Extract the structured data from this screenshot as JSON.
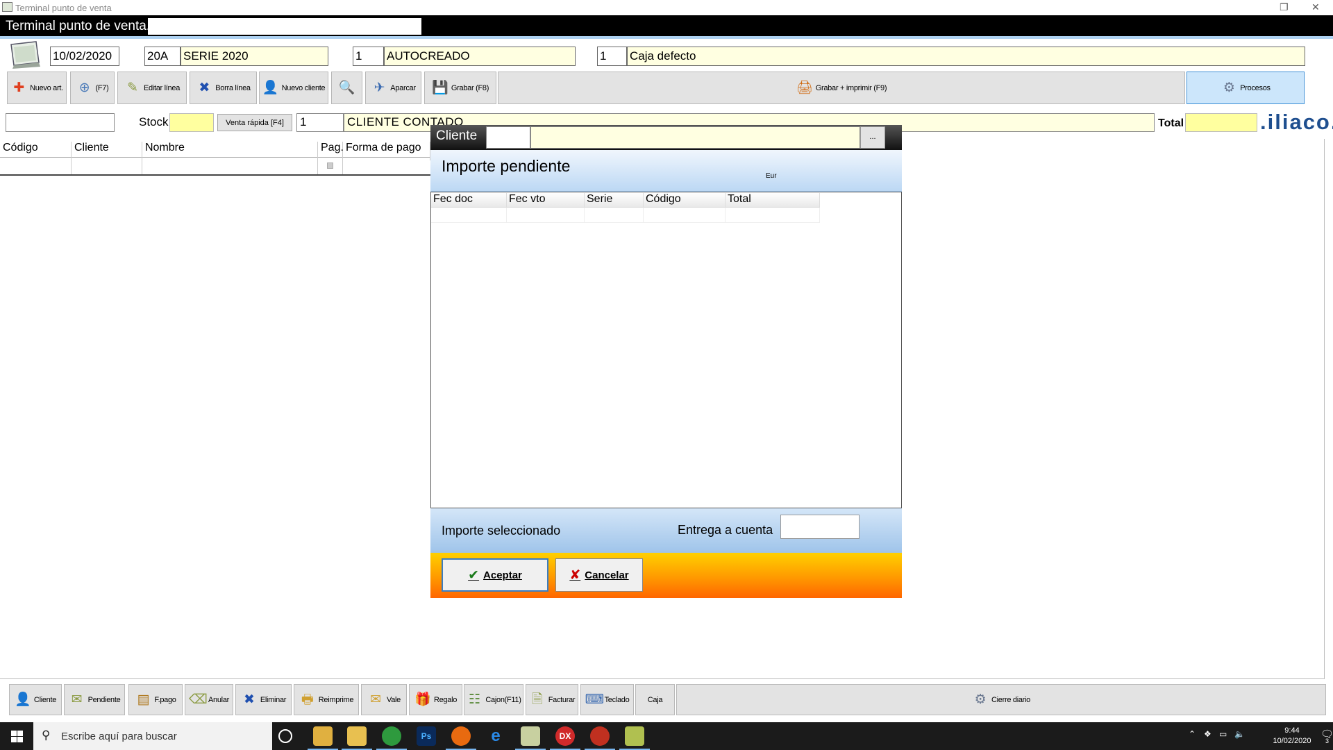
{
  "window": {
    "title": "Terminal punto de venta",
    "restore_glyph": "❐",
    "close_glyph": "✕"
  },
  "header": {
    "title": "Terminal punto de venta."
  },
  "info": {
    "date": "10/02/2020",
    "series_code": "20A",
    "series_name": "SERIE 2020",
    "user_code": "1",
    "user_name": "AUTOCREADO",
    "cash_code": "1",
    "cash_name": "Caja defecto"
  },
  "toolbar": {
    "new_article": "Nuevo art.",
    "f7": "(F7)",
    "edit_line": "Editar línea",
    "delete_line": "Borra línea",
    "new_client": "Nuevo cliente",
    "park": "Aparcar",
    "save": "Grabar (F8)",
    "save_print": "Grabar + imprimir (F9)",
    "processes": "Procesos"
  },
  "search": {
    "stock_label": "Stock",
    "quick_sale": "Venta rápida [F4]",
    "client_code": "1",
    "client_name": "CLIENTE CONTADO",
    "total_label": "Total",
    "brand": ".iliaco."
  },
  "main_table": {
    "columns": [
      "Código",
      "Cliente",
      "Nombre",
      "Pag.",
      "Forma de pago"
    ]
  },
  "dialog": {
    "title": "Cliente",
    "browse": "...",
    "pending_label": "Importe pendiente",
    "currency": "Eur",
    "columns": [
      "Fec doc",
      "Fec vto",
      "Serie",
      "Código",
      "Total"
    ],
    "selected_label": "Importe seleccionado",
    "on_account_label": "Entrega a cuenta",
    "accept": "Aceptar",
    "cancel": "Cancelar"
  },
  "bottom_toolbar": {
    "client": "Cliente",
    "pending": "Pendiente",
    "payment_method": "F.pago",
    "void": "Anular",
    "delete": "Eliminar",
    "reprint": "Reimprime",
    "voucher": "Vale",
    "gift": "Regalo",
    "drawer": "Cajon(F11)",
    "invoice": "Facturar",
    "keyboard": "Teclado",
    "cash": "Caja",
    "daily_close": "Cierre diario"
  },
  "taskbar": {
    "search_placeholder": "Escribe aquí para buscar",
    "time": "9:44",
    "date": "10/02/2020",
    "notifications": "3"
  }
}
